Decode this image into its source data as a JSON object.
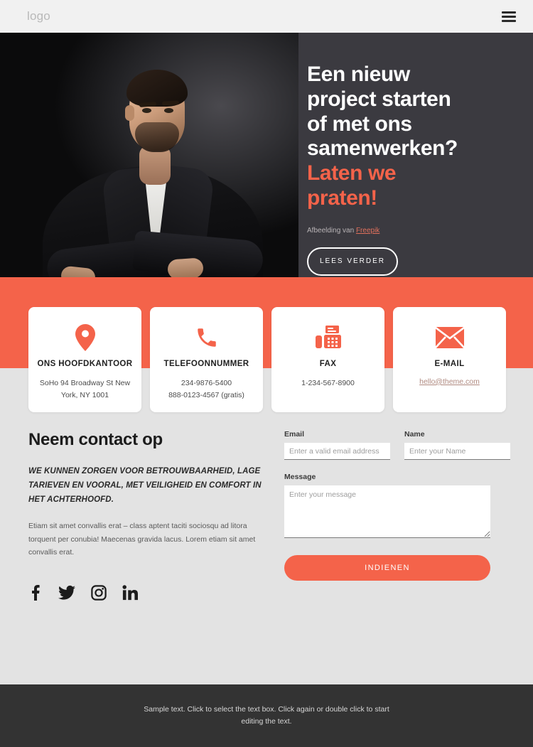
{
  "header": {
    "logo": "logo",
    "menu_icon": "hamburger-menu-icon"
  },
  "hero": {
    "heading_line1": "Een nieuw",
    "heading_line2": "project starten",
    "heading_line3": "of met ons",
    "heading_line4": "samenwerken?",
    "heading_accent1": "Laten we",
    "heading_accent2": "praten!",
    "credit_prefix": "Afbeelding van ",
    "credit_link": "Freepik",
    "cta_label": "LEES VERDER",
    "image_alt": "man-in-black-blazer-arms-crossed"
  },
  "cards": [
    {
      "icon": "location-pin-icon",
      "title": "ONS HOOFDKANTOOR",
      "lines": [
        "SoHo 94 Broadway St New",
        "York, NY 1001"
      ],
      "link": null
    },
    {
      "icon": "phone-icon",
      "title": "TELEFOONNUMMER",
      "lines": [
        "234-9876-5400",
        "888-0123-4567 (gratis)"
      ],
      "link": null
    },
    {
      "icon": "fax-icon",
      "title": "FAX",
      "lines": [
        "1-234-567-8900"
      ],
      "link": null
    },
    {
      "icon": "envelope-icon",
      "title": "E-MAIL",
      "lines": [],
      "link": "hello@theme.com"
    }
  ],
  "contact": {
    "heading": "Neem contact op",
    "lead": "WE KUNNEN ZORGEN VOOR BETROUWBAARHEID, LAGE TARIEVEN EN VOORAL, MET VEILIGHEID EN COMFORT IN HET ACHTERHOOFD.",
    "body": "Etiam sit amet convallis erat – class aptent taciti sociosqu ad litora torquent per conubia! Maecenas gravida lacus. Lorem etiam sit amet convallis erat.",
    "socials": [
      {
        "name": "facebook-icon"
      },
      {
        "name": "twitter-icon"
      },
      {
        "name": "instagram-icon"
      },
      {
        "name": "linkedin-icon"
      }
    ]
  },
  "form": {
    "email_label": "Email",
    "email_placeholder": "Enter a valid email address",
    "email_value": "",
    "name_label": "Name",
    "name_placeholder": "Enter your Name",
    "name_value": "",
    "message_label": "Message",
    "message_placeholder": "Enter your message",
    "message_value": "",
    "submit_label": "INDIENEN"
  },
  "footer": {
    "text": "Sample text. Click to select the text box. Click again or double click to start editing the text."
  },
  "colors": {
    "accent": "#f4634a",
    "hero_bg": "#3b3a40",
    "page_bg": "#e3e3e3",
    "footer_bg": "#333333",
    "header_bg": "#f1f1f1"
  }
}
